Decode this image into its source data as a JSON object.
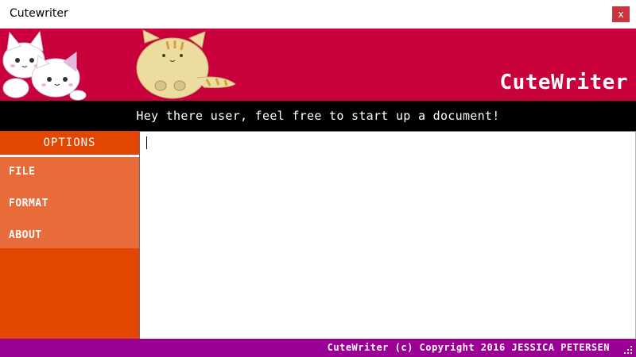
{
  "window": {
    "title": "Cutewriter",
    "close_label": "x"
  },
  "header": {
    "brand": "CuteWriter"
  },
  "greeting": "Hey there user, feel free to start up a document!",
  "sidebar": {
    "header": "OPTIONS",
    "items": [
      {
        "label": "FILE"
      },
      {
        "label": "FORMAT"
      },
      {
        "label": "ABOUT"
      }
    ]
  },
  "editor": {
    "value": ""
  },
  "footer": {
    "copyright": "CuteWriter (c) Copyright 2016 JESSICA PETERSEN"
  },
  "colors": {
    "header": "#c8003c",
    "greeting_bar": "#000000",
    "sidebar": "#e24600",
    "menu": "#e86b3a",
    "statusbar": "#9b0094",
    "close_button": "#c8353f"
  }
}
